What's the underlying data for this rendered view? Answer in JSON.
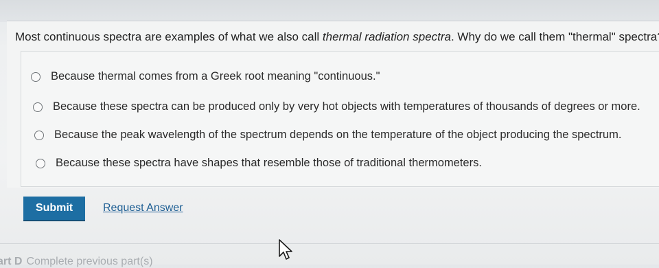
{
  "question": {
    "text_before": "Most continuous spectra are examples of what we also call ",
    "text_italic": "thermal radiation spectra",
    "text_after": ". Why do we call them \"thermal\" spectra?"
  },
  "options": [
    {
      "label": "Because thermal comes from a Greek root meaning \"continuous.\"",
      "selected": false
    },
    {
      "label": "Because these spectra can be produced only by very hot objects with temperatures of thousands of degrees or more.",
      "selected": false
    },
    {
      "label": "Because the peak wavelength of the spectrum depends on the temperature of the object producing the spectrum.",
      "selected": false
    },
    {
      "label": "Because these spectra have shapes that resemble those of traditional thermometers.",
      "selected": false
    }
  ],
  "actions": {
    "submit_label": "Submit",
    "request_answer_label": "Request Answer"
  },
  "next_part": {
    "label": "art D",
    "status": "Complete previous part(s)"
  },
  "colors": {
    "submit_bg": "#1d6ea3",
    "link": "#1f5f94"
  },
  "icons": {
    "cursor": "mouse-pointer-icon",
    "radio": "radio-unselected-icon"
  }
}
